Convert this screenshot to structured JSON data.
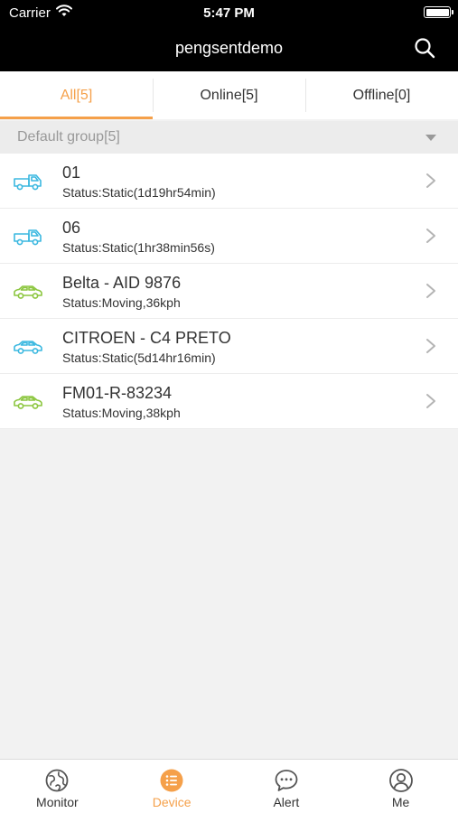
{
  "status_bar": {
    "carrier": "Carrier",
    "time": "5:47 PM"
  },
  "nav": {
    "title": "pengsentdemo",
    "search_icon": "search-icon"
  },
  "tabs": [
    {
      "label": "All[5]",
      "active": true
    },
    {
      "label": "Online[5]",
      "active": false
    },
    {
      "label": "Offline[0]",
      "active": false
    }
  ],
  "group": {
    "label": "Default group[5]"
  },
  "devices": [
    {
      "name": "01",
      "status": "Status:Static(1d19hr54min)",
      "icon": "truck-icon",
      "color": "#3bb8e0"
    },
    {
      "name": "06",
      "status": "Status:Static(1hr38min56s)",
      "icon": "truck-icon",
      "color": "#3bb8e0"
    },
    {
      "name": "Belta - AID 9876",
      "status": "Status:Moving,36kph",
      "icon": "car-icon",
      "color": "#8cc63f"
    },
    {
      "name": "CITROEN - C4 PRETO",
      "status": "Status:Static(5d14hr16min)",
      "icon": "car-icon",
      "color": "#3bb8e0"
    },
    {
      "name": "FM01-R-83234",
      "status": "Status:Moving,38kph",
      "icon": "car-icon",
      "color": "#8cc63f"
    }
  ],
  "bottom_nav": [
    {
      "label": "Monitor",
      "icon": "globe-icon",
      "active": false
    },
    {
      "label": "Device",
      "icon": "list-icon",
      "active": true
    },
    {
      "label": "Alert",
      "icon": "chat-bubble-icon",
      "active": false
    },
    {
      "label": "Me",
      "icon": "user-icon",
      "active": false
    }
  ],
  "colors": {
    "accent": "#f5a04a",
    "static": "#3bb8e0",
    "moving": "#8cc63f"
  }
}
